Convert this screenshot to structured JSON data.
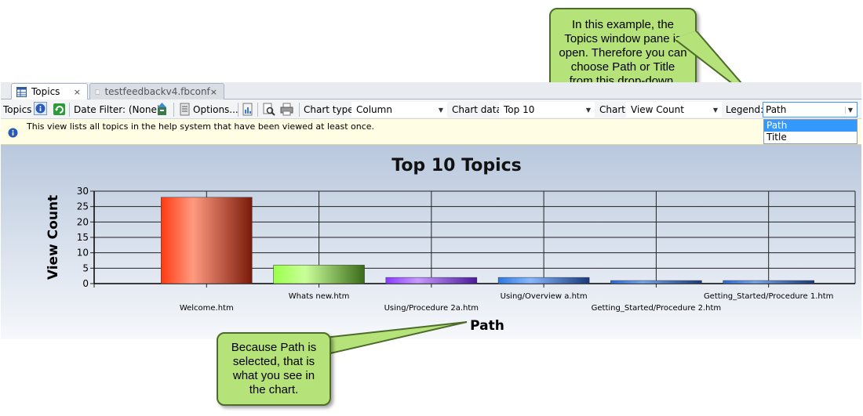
{
  "tabs": [
    {
      "label": "Topics",
      "close": "×"
    },
    {
      "label": "testfeedbackv4.fbconf",
      "close": "×"
    }
  ],
  "toolbar": {
    "topics_label": "Topics",
    "date_filter": "Date Filter: (None)",
    "options": "Options...",
    "chart_type_label": "Chart type:",
    "chart_type_value": "Column",
    "chart_data_label": "Chart data:",
    "chart_data_value": "Top 10",
    "chart_label": "Chart:",
    "chart_value": "View Count",
    "legend_label": "Legend:",
    "legend_value": "Path",
    "legend_options": [
      "Path",
      "Title"
    ]
  },
  "info": {
    "text": "This view lists all topics in the help system that have been viewed at least once."
  },
  "callouts": {
    "top": [
      "In this example, the",
      "Topics window pane is",
      "open. Therefore you can",
      "choose Path or Title",
      "from this drop-down."
    ],
    "bottom": [
      "Because Path is",
      "selected, that is",
      "what you see in",
      "the chart."
    ]
  },
  "colors": {
    "callout_fill": "#b6e27a",
    "selection": "#3399ff",
    "infobar": "#fffde3"
  },
  "chart_data": {
    "type": "bar",
    "title": "Top 10 Topics",
    "xlabel": "Path",
    "ylabel": "View Count",
    "ylim": [
      0,
      30
    ],
    "yticks": [
      0,
      5,
      10,
      15,
      20,
      25,
      30
    ],
    "categories": [
      "Welcome.htm",
      "Whats new.htm",
      "Using/Procedure 2a.htm",
      "Using/Overview a.htm",
      "Getting_Started/Procedure 2.htm",
      "Getting_Started/Procedure 1.htm"
    ],
    "values": [
      28,
      6,
      2,
      2,
      1,
      1
    ],
    "bar_colors": [
      [
        "#ff3a10",
        "#ff9a80",
        "#7a1a0a"
      ],
      [
        "#9aff4a",
        "#caff9a",
        "#3a6a1a"
      ],
      [
        "#8a3aff",
        "#c89aff",
        "#4a1a9a"
      ],
      [
        "#2a7ae0",
        "#8ab8ff",
        "#1a3a7a"
      ],
      [
        "#2a6ad0",
        "#7aa8f0",
        "#1a3a7a"
      ],
      [
        "#2a6ad0",
        "#7aa8f0",
        "#1a3a7a"
      ]
    ],
    "grid": true,
    "legend": "none"
  }
}
